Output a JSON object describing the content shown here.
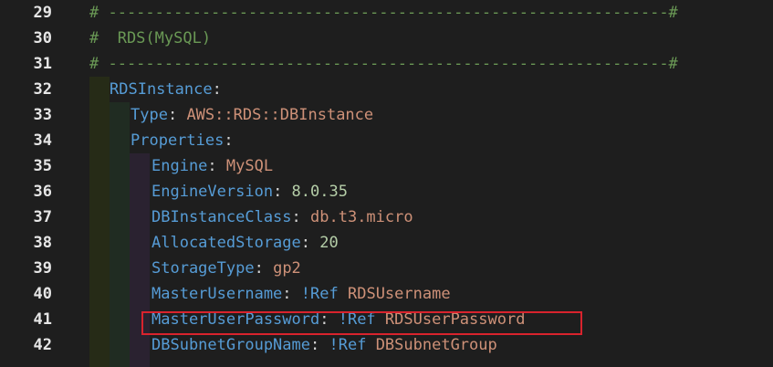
{
  "editor": {
    "lines": [
      {
        "num": "29",
        "parts": [
          {
            "t": "# ------------------------------------------------------------#",
            "c": "comment"
          }
        ]
      },
      {
        "num": "30",
        "parts": [
          {
            "t": "#  RDS(MySQL)",
            "c": "comment"
          }
        ]
      },
      {
        "num": "31",
        "parts": [
          {
            "t": "# ------------------------------------------------------------#",
            "c": "comment"
          }
        ]
      },
      {
        "num": "32",
        "parts": [
          {
            "t": "RDSInstance",
            "c": "key"
          },
          {
            "t": ":",
            "c": "punc"
          }
        ]
      },
      {
        "num": "33",
        "parts": [
          {
            "t": "Type",
            "c": "key"
          },
          {
            "t": ": ",
            "c": "punc"
          },
          {
            "t": "AWS::RDS::DBInstance",
            "c": "str"
          }
        ]
      },
      {
        "num": "34",
        "parts": [
          {
            "t": "Properties",
            "c": "key"
          },
          {
            "t": ":",
            "c": "punc"
          }
        ]
      },
      {
        "num": "35",
        "parts": [
          {
            "t": "Engine",
            "c": "key"
          },
          {
            "t": ": ",
            "c": "punc"
          },
          {
            "t": "MySQL",
            "c": "str"
          }
        ]
      },
      {
        "num": "36",
        "parts": [
          {
            "t": "EngineVersion",
            "c": "key"
          },
          {
            "t": ": ",
            "c": "punc"
          },
          {
            "t": "8.0.35",
            "c": "num"
          }
        ]
      },
      {
        "num": "37",
        "parts": [
          {
            "t": "DBInstanceClass",
            "c": "key"
          },
          {
            "t": ": ",
            "c": "punc"
          },
          {
            "t": "db.t3.micro",
            "c": "str"
          }
        ]
      },
      {
        "num": "38",
        "parts": [
          {
            "t": "AllocatedStorage",
            "c": "key"
          },
          {
            "t": ": ",
            "c": "punc"
          },
          {
            "t": "20",
            "c": "num"
          }
        ]
      },
      {
        "num": "39",
        "parts": [
          {
            "t": "StorageType",
            "c": "key"
          },
          {
            "t": ": ",
            "c": "punc"
          },
          {
            "t": "gp2",
            "c": "str"
          }
        ]
      },
      {
        "num": "40",
        "parts": [
          {
            "t": "MasterUsername",
            "c": "key"
          },
          {
            "t": ": ",
            "c": "punc"
          },
          {
            "t": "!Ref",
            "c": "tag"
          },
          {
            "t": " ",
            "c": "punc"
          },
          {
            "t": "RDSUsername",
            "c": "str"
          }
        ]
      },
      {
        "num": "41",
        "parts": [
          {
            "t": "MasterUserPassword",
            "c": "key"
          },
          {
            "t": ": ",
            "c": "punc"
          },
          {
            "t": "!Ref",
            "c": "tag"
          },
          {
            "t": " ",
            "c": "punc"
          },
          {
            "t": "RDSUserPassword",
            "c": "str"
          }
        ]
      },
      {
        "num": "42",
        "parts": [
          {
            "t": "DBSubnetGroupName",
            "c": "key"
          },
          {
            "t": ": ",
            "c": "punc"
          },
          {
            "t": "!Ref",
            "c": "tag"
          },
          {
            "t": " ",
            "c": "punc"
          },
          {
            "t": "DBSubnetGroup",
            "c": "str"
          }
        ]
      }
    ],
    "colors": {
      "background": "#1e1e1e",
      "comment": "#6a9955",
      "key": "#569cd6",
      "string": "#ce9178",
      "number": "#b5cea8",
      "highlight_border": "#d9232d"
    }
  }
}
